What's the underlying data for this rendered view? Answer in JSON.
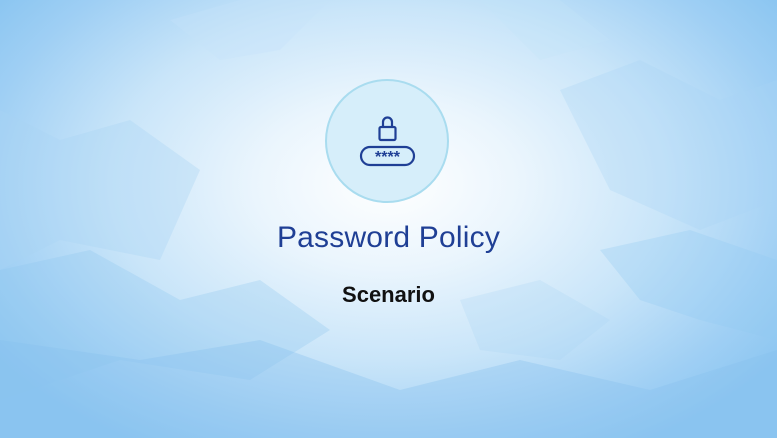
{
  "slide": {
    "title": "Password Policy",
    "subtitle": "Scenario",
    "icon": "lock-password-icon",
    "password_mask": "****"
  },
  "colors": {
    "title": "#1f3f95",
    "subtitle": "#111111",
    "badge_fill": "#d6eefa",
    "badge_border": "#a9dcef",
    "icon_stroke": "#1f3f95"
  }
}
